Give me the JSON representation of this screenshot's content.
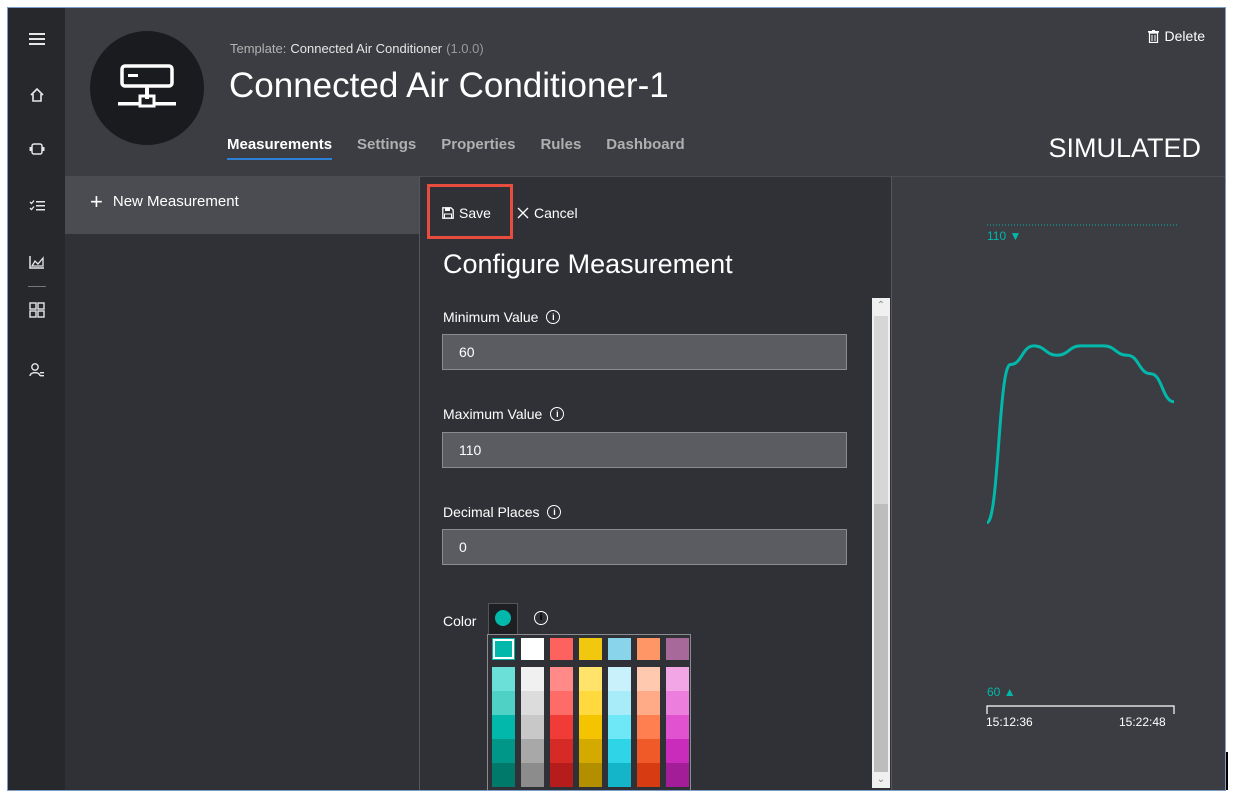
{
  "rail": {
    "icons": [
      "menu-icon",
      "home-icon",
      "device-icon",
      "rules-icon",
      "analytics-icon",
      "dashboard-icon",
      "users-icon"
    ]
  },
  "header": {
    "template_label": "Template:",
    "template_name": "Connected Air Conditioner",
    "template_version": "(1.0.0)",
    "device_title": "Connected Air Conditioner-1",
    "tabs": [
      "Measurements",
      "Settings",
      "Properties",
      "Rules",
      "Dashboard"
    ],
    "active_tab": "Measurements",
    "delete_label": "Delete",
    "status": "SIMULATED"
  },
  "left": {
    "new_measurement_label": "New Measurement"
  },
  "config": {
    "save_label": "Save",
    "cancel_label": "Cancel",
    "title": "Configure Measurement",
    "min_label": "Minimum Value",
    "min_value": "60",
    "max_label": "Maximum Value",
    "max_value": "110",
    "decimal_label": "Decimal Places",
    "decimal_value": "0",
    "color_label": "Color",
    "selected_color": "#01b8aa"
  },
  "palette": {
    "columns": [
      [
        "#01b8aa",
        "#6be0d8",
        "#4fd1c5",
        "#01b8aa",
        "#009688",
        "#00796b"
      ],
      [
        "#ffffff",
        "#f0f0f0",
        "#dcdcdc",
        "#c8c8c8",
        "#a8a8a8",
        "#8c8c8c"
      ],
      [
        "#fd625e",
        "#ff8a87",
        "#ff6b66",
        "#f03b36",
        "#d62a26",
        "#b71c1c"
      ],
      [
        "#f2c80f",
        "#ffe36b",
        "#ffd93d",
        "#f5c400",
        "#d4a900",
        "#b38f00"
      ],
      [
        "#8ad4eb",
        "#c9f1fb",
        "#a8ecf9",
        "#6ee8f7",
        "#2fd4e6",
        "#14b5c8"
      ],
      [
        "#fe9666",
        "#ffc9b0",
        "#ffab88",
        "#ff7f50",
        "#f05a28",
        "#d63b12"
      ],
      [
        "#a66999",
        "#f3a6e6",
        "#ec7fdd",
        "#e052d0",
        "#c92bbb",
        "#a31d98"
      ]
    ]
  },
  "chart_data": {
    "type": "line",
    "max_marker": "110",
    "min_marker": "60",
    "x_ticks": [
      "15:12:36",
      "15:22:48"
    ],
    "series": [
      {
        "values": [
          78,
          95,
          97,
          96,
          97,
          97,
          96,
          94,
          91
        ]
      }
    ],
    "ylim": [
      60,
      110
    ],
    "color": "#01b8aa"
  }
}
